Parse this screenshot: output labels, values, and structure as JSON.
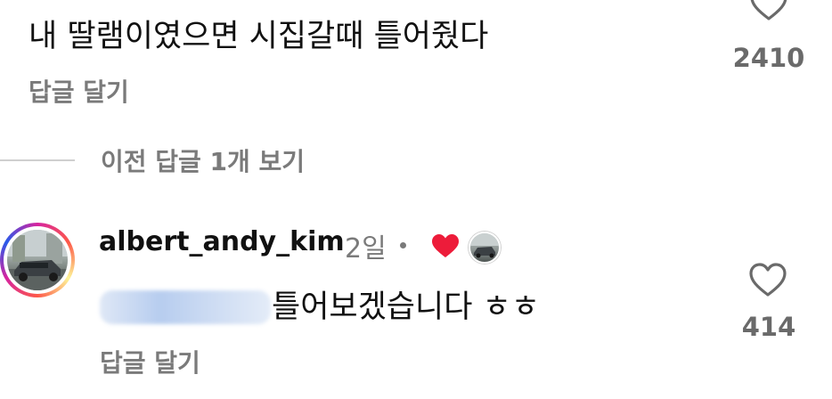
{
  "top_comment": {
    "text": "내 딸램이였으면 시집갈때 틀어줬다",
    "reply_label": "답글 달기",
    "like_count": "2410",
    "like_icon": "heart-outline-icon"
  },
  "view_previous": {
    "label": "이전 답글 1개 보기"
  },
  "reply": {
    "username": "albert_andy_kim",
    "time": "2일",
    "separator": "•",
    "creator_liked_icon": "red-heart-icon",
    "text": "틀어보겠습니다 ㅎㅎ",
    "reply_label": "답글 달기",
    "like_count": "414",
    "like_icon": "heart-outline-icon"
  },
  "colors": {
    "primary_text": "#111111",
    "secondary_text": "#7a7a7a",
    "like_red": "#ed1c3a"
  }
}
